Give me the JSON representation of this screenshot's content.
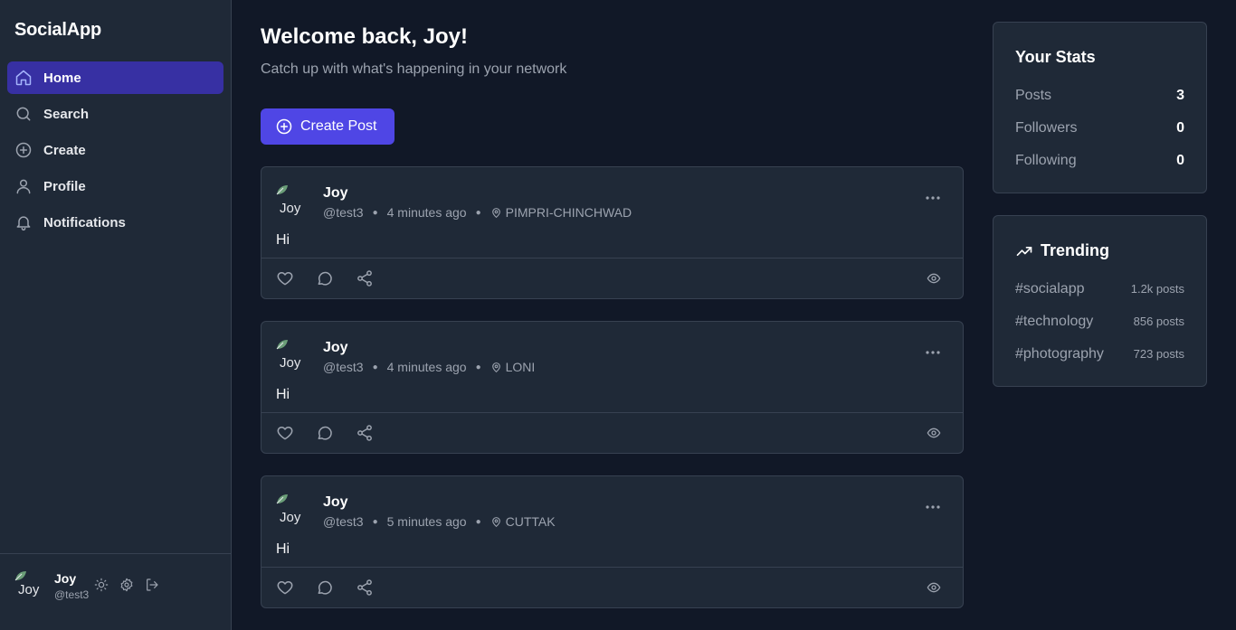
{
  "app": {
    "brand": "SocialApp"
  },
  "sidebar": {
    "items": [
      {
        "label": "Home",
        "icon": "home-icon",
        "active": true
      },
      {
        "label": "Search",
        "icon": "search-icon",
        "active": false
      },
      {
        "label": "Create",
        "icon": "plus-circle-icon",
        "active": false
      },
      {
        "label": "Profile",
        "icon": "user-icon",
        "active": false
      },
      {
        "label": "Notifications",
        "icon": "bell-icon",
        "active": false
      }
    ],
    "user": {
      "name": "Joy",
      "handle": "@test3",
      "avatar_alt": "Joy"
    }
  },
  "main": {
    "welcome": "Welcome back, Joy!",
    "subtitle": "Catch up with what's happening in your network",
    "create_label": "Create Post",
    "posts": [
      {
        "author": "Joy",
        "handle": "@test3",
        "time": "4 minutes ago",
        "location": "PIMPRI-CHINCHWAD",
        "body": "Hi",
        "avatar_alt": "Joy"
      },
      {
        "author": "Joy",
        "handle": "@test3",
        "time": "4 minutes ago",
        "location": "LONI",
        "body": "Hi",
        "avatar_alt": "Joy"
      },
      {
        "author": "Joy",
        "handle": "@test3",
        "time": "5 minutes ago",
        "location": "CUTTAK",
        "body": "Hi",
        "avatar_alt": "Joy"
      }
    ]
  },
  "stats": {
    "title": "Your Stats",
    "rows": [
      {
        "label": "Posts",
        "value": "3"
      },
      {
        "label": "Followers",
        "value": "0"
      },
      {
        "label": "Following",
        "value": "0"
      }
    ]
  },
  "trending": {
    "title": "Trending",
    "items": [
      {
        "tag": "#socialapp",
        "count": "1.2k posts"
      },
      {
        "tag": "#technology",
        "count": "856 posts"
      },
      {
        "tag": "#photography",
        "count": "723 posts"
      }
    ]
  },
  "colors": {
    "accent": "#4f46e5",
    "active_nav": "#3730a3",
    "background": "#111827",
    "surface": "#1f2937"
  }
}
